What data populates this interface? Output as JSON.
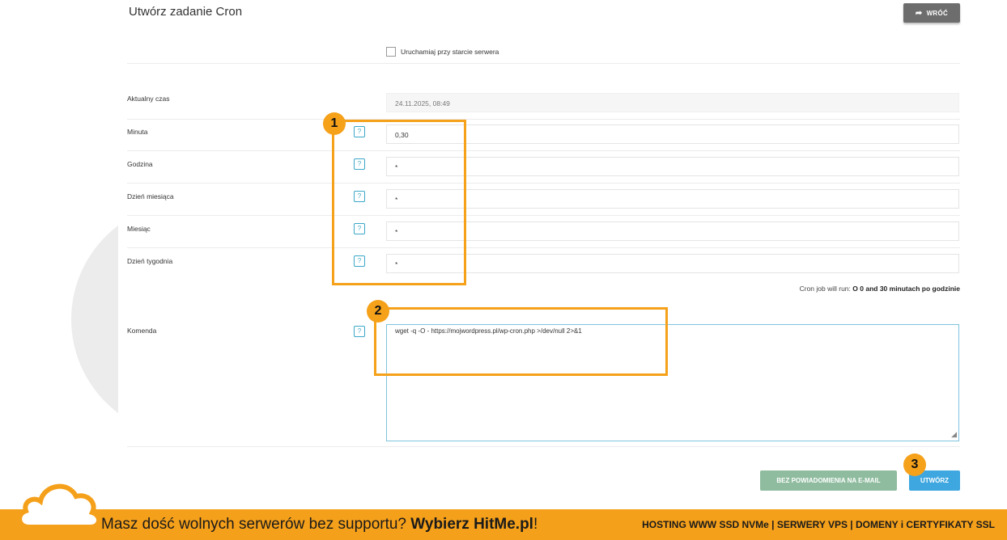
{
  "header": {
    "title": "Utwórz zadanie Cron",
    "back_label": "WRÓĆ"
  },
  "startup_checkbox": {
    "label": "Uruchamiaj przy starcie serwera",
    "checked": false
  },
  "fields": {
    "current_time": {
      "label": "Aktualny czas",
      "value": "24.11.2025, 08:49"
    },
    "minute": {
      "label": "Minuta",
      "value": "0,30"
    },
    "hour": {
      "label": "Godzina",
      "value": "*"
    },
    "day_of_month": {
      "label": "Dzień miesiąca",
      "value": "*"
    },
    "month": {
      "label": "Miesiąc",
      "value": "*"
    },
    "day_of_week": {
      "label": "Dzień tygodnia",
      "value": "*"
    },
    "command": {
      "label": "Komenda",
      "value": "wget -q -O - https://mojwordpress.pl/wp-cron.php >/dev/null 2>&1"
    }
  },
  "help_glyph": "?",
  "run_info": {
    "prefix": "Cron job will run:",
    "value": "O 0 and 30 minutach po godzinie"
  },
  "buttons": {
    "no_email": "BEZ POWIADOMIENIA NA E-MAIL",
    "create": "UTWÓRZ"
  },
  "annotations": {
    "badge1": "1",
    "badge2": "2",
    "badge3": "3",
    "color": "#f5a11a"
  },
  "banner": {
    "text_normal": "Masz dość wolnych serwerów bez supportu?",
    "text_bold": "Wybierz HitMe.pl",
    "text_end": "!",
    "right": "HOSTING WWW SSD NVMe | SERWERY VPS | DOMENY i CERTYFIKATY SSL",
    "color": "#f5a01a"
  },
  "colors": {
    "create_button": "#3fa7e0",
    "no_email_button": "#8fbc9f",
    "back_button": "#6d6d6d",
    "help_icon": "#3ba7c9"
  }
}
